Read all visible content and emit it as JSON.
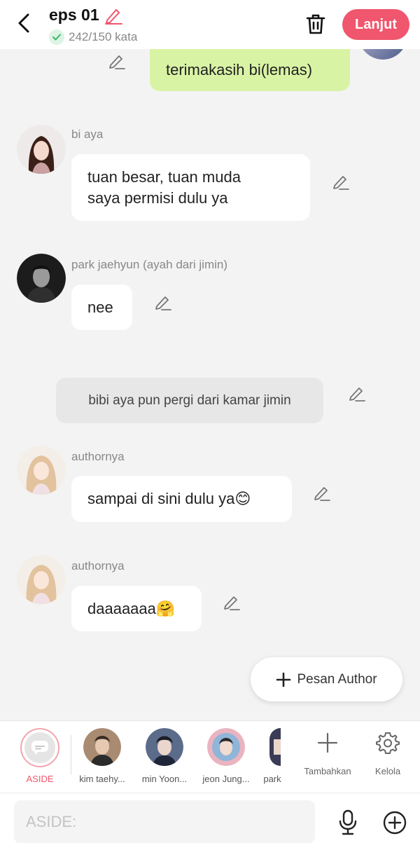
{
  "header": {
    "title": "eps 01",
    "word_count": "242/150 kata",
    "next_label": "Lanjut"
  },
  "messages": [
    {
      "type": "mine",
      "text": "terimakasih bi(lemas)"
    },
    {
      "type": "char",
      "name": "bi  aya",
      "lines": [
        "tuan besar, tuan muda",
        "saya permisi dulu ya"
      ]
    },
    {
      "type": "char",
      "name": "park jaehyun (ayah dari jimin)",
      "text": "nee"
    },
    {
      "type": "narration",
      "text": "bibi aya pun pergi dari kamar jimin"
    },
    {
      "type": "char",
      "name": "authornya",
      "text": "sampai di sini dulu ya😊"
    },
    {
      "type": "char",
      "name": "authornya",
      "text": "daaaaaaa🤗"
    }
  ],
  "fab_label": "Pesan Author",
  "character_bar": {
    "aside_label": "ASIDE",
    "characters": [
      {
        "label": "kim taehy..."
      },
      {
        "label": "min Yoon..."
      },
      {
        "label": "jeon Jung..."
      },
      {
        "label": "park"
      }
    ],
    "add_label": "Tambahkan",
    "manage_label": "Kelola"
  },
  "input": {
    "placeholder": "ASIDE:"
  },
  "colors": {
    "accent": "#f0566d",
    "my_bubble": "#d9f3a5",
    "background": "#f3f3f3"
  }
}
